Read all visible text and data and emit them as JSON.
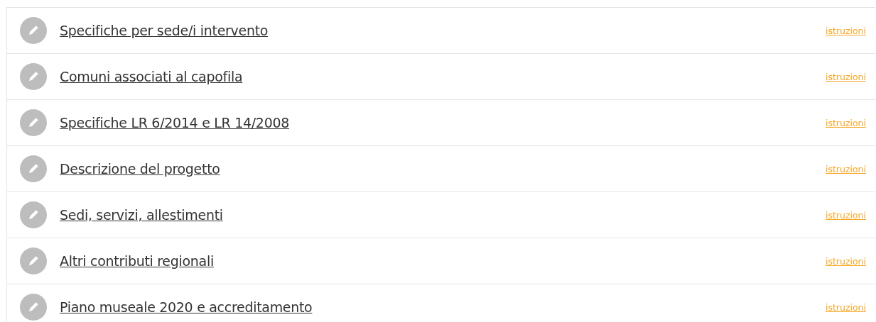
{
  "sections": [
    {
      "title": "Specifiche per sede/i intervento",
      "link": "istruzioni"
    },
    {
      "title": "Comuni associati al capofila",
      "link": "istruzioni"
    },
    {
      "title": "Specifiche LR 6/2014 e LR 14/2008",
      "link": "istruzioni"
    },
    {
      "title": "Descrizione del progetto",
      "link": "istruzioni"
    },
    {
      "title": "Sedi, servizi, allestimenti",
      "link": "istruzioni"
    },
    {
      "title": "Altri contributi regionali",
      "link": "istruzioni"
    },
    {
      "title": "Piano museale 2020 e accreditamento",
      "link": "istruzioni"
    }
  ]
}
